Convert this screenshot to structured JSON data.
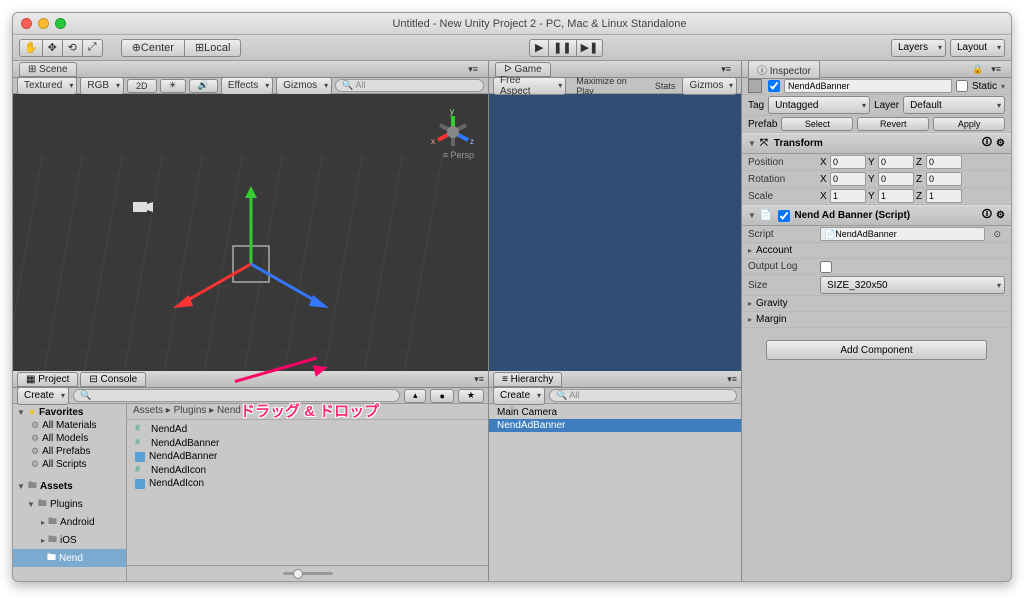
{
  "window": {
    "title": "Untitled - New Unity Project 2 - PC, Mac & Linux Standalone"
  },
  "toolbar": {
    "center": "Center",
    "local": "Local",
    "layers": "Layers",
    "layout": "Layout"
  },
  "scene": {
    "tab": "Scene",
    "textured": "Textured",
    "rgb": "RGB",
    "twod": "2D",
    "effects": "Effects",
    "gizmos": "Gizmos",
    "persp": "Persp"
  },
  "game": {
    "tab": "Game",
    "aspect": "Free Aspect",
    "maximize": "Maximize on Play",
    "stats": "Stats",
    "gizmos": "Gizmos"
  },
  "project": {
    "tab_project": "Project",
    "tab_console": "Console",
    "create": "Create",
    "favorites": "Favorites",
    "fav_items": [
      "All Materials",
      "All Models",
      "All Prefabs",
      "All Scripts"
    ],
    "assets": "Assets",
    "tree": [
      "Plugins",
      "Android",
      "iOS",
      "Nend"
    ],
    "breadcrumb": "Assets ▸ Plugins ▸ Nend",
    "items": [
      "NendAd",
      "NendAdBanner",
      "NendAdBanner",
      "NendAdIcon",
      "NendAdIcon"
    ]
  },
  "hierarchy": {
    "tab": "Hierarchy",
    "create": "Create",
    "items": [
      "Main Camera",
      "NendAdBanner"
    ]
  },
  "inspector": {
    "tab": "Inspector",
    "name": "NendAdBanner",
    "static": "Static",
    "tag_lbl": "Tag",
    "tag_val": "Untagged",
    "layer_lbl": "Layer",
    "layer_val": "Default",
    "prefab_lbl": "Prefab",
    "select": "Select",
    "revert": "Revert",
    "apply": "Apply",
    "transform": "Transform",
    "position": "Position",
    "rotation": "Rotation",
    "scale": "Scale",
    "pos": {
      "x": "0",
      "y": "0",
      "z": "0"
    },
    "rot": {
      "x": "0",
      "y": "0",
      "z": "0"
    },
    "scl": {
      "x": "1",
      "y": "1",
      "z": "1"
    },
    "component": "Nend Ad Banner (Script)",
    "script_lbl": "Script",
    "script_val": "NendAdBanner",
    "account": "Account",
    "outputlog": "Output Log",
    "size_lbl": "Size",
    "size_val": "SIZE_320x50",
    "gravity": "Gravity",
    "margin": "Margin",
    "add": "Add Component"
  },
  "overlay": {
    "dragdrop": "ドラッグ & ドロップ"
  }
}
